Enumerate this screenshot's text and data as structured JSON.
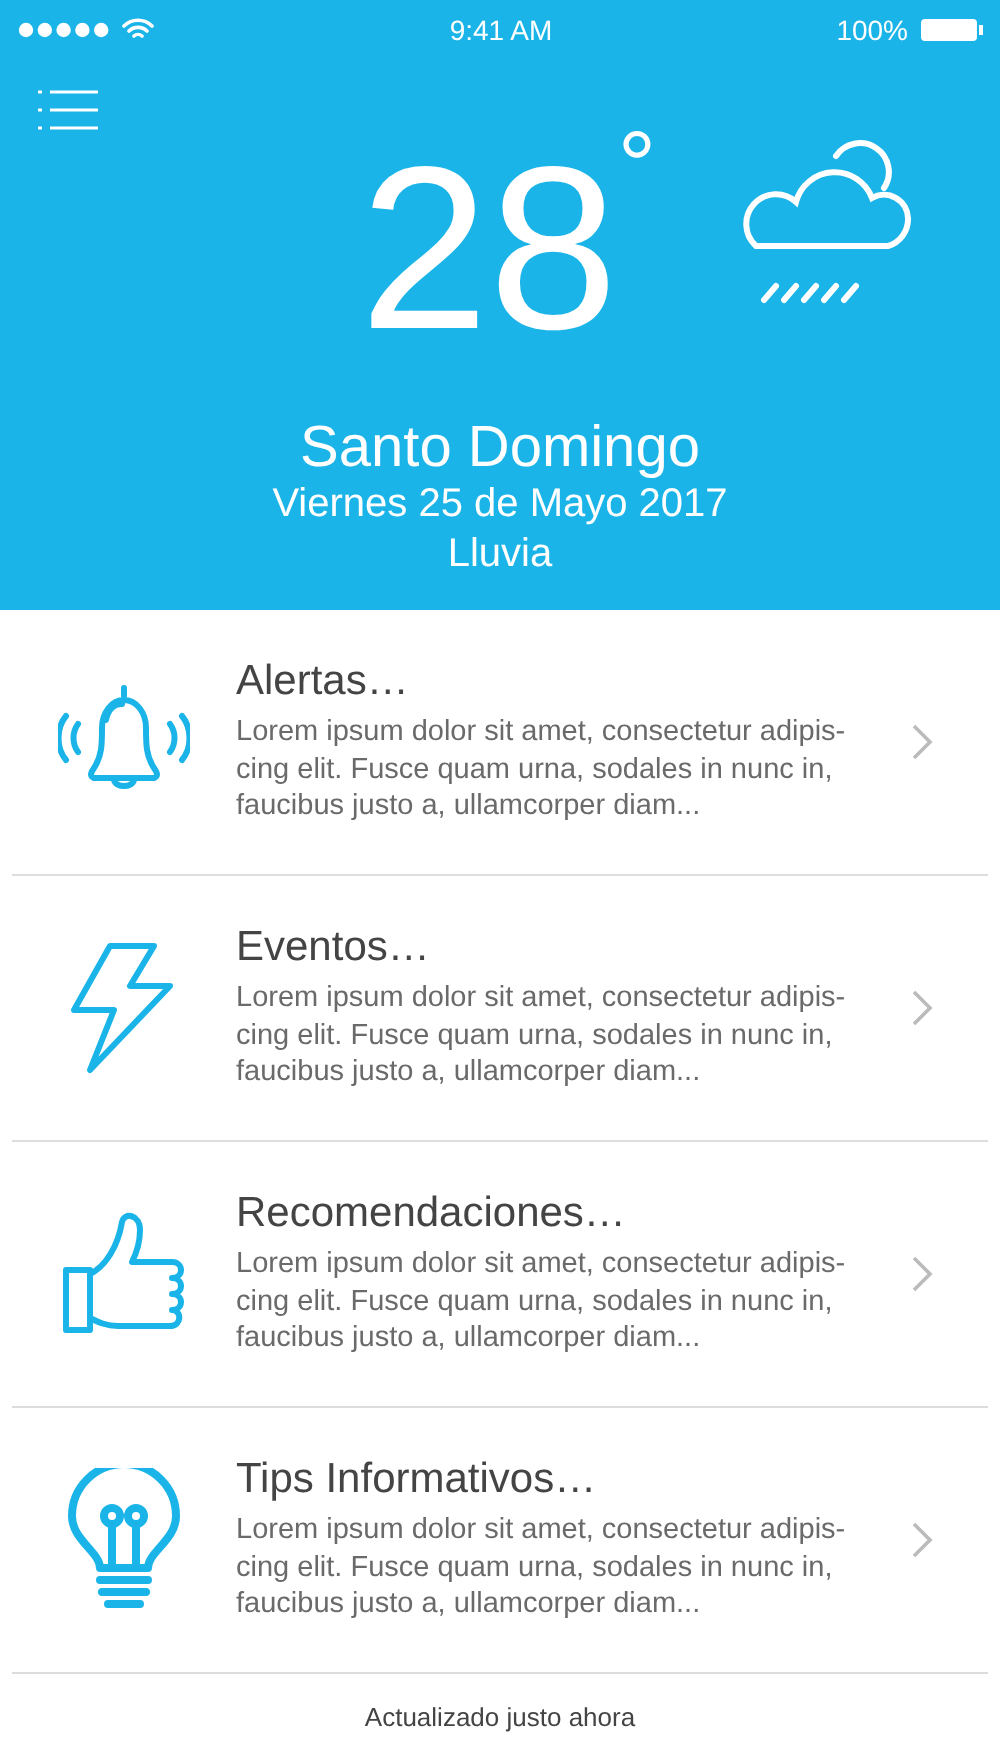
{
  "status_bar": {
    "time": "9:41 AM",
    "battery": "100%"
  },
  "weather": {
    "temperature": "28",
    "degree": "°",
    "city": "Santo Domingo",
    "date": "Viernes 25 de Mayo 2017",
    "condition": "Lluvia"
  },
  "items": [
    {
      "kind": "bell",
      "title": "Alertas…",
      "lines": [
        "Lorem ipsum dolor sit amet, consectetur adipis-",
        "cing elit. Fusce quam urna, sodales in nunc in,",
        "faucibus justo a, ullamcorper diam..."
      ]
    },
    {
      "kind": "bolt",
      "title": "Eventos…",
      "lines": [
        "Lorem ipsum dolor sit amet, consectetur adipis-",
        "cing elit. Fusce quam urna, sodales in nunc in,",
        "faucibus justo a, ullamcorper diam..."
      ]
    },
    {
      "kind": "thumb",
      "title": "Recomendaciones…",
      "lines": [
        "Lorem ipsum dolor sit amet, consectetur adipis-",
        "cing elit. Fusce quam urna, sodales in nunc in,",
        "faucibus justo a, ullamcorper diam..."
      ]
    },
    {
      "kind": "bulb",
      "title": "Tips Informativos…",
      "lines": [
        "Lorem ipsum dolor sit amet, consectetur adipis-",
        "cing elit. Fusce quam urna, sodales in nunc in,",
        "faucibus justo a, ullamcorper diam..."
      ]
    }
  ],
  "footer": "Actualizado justo ahora"
}
